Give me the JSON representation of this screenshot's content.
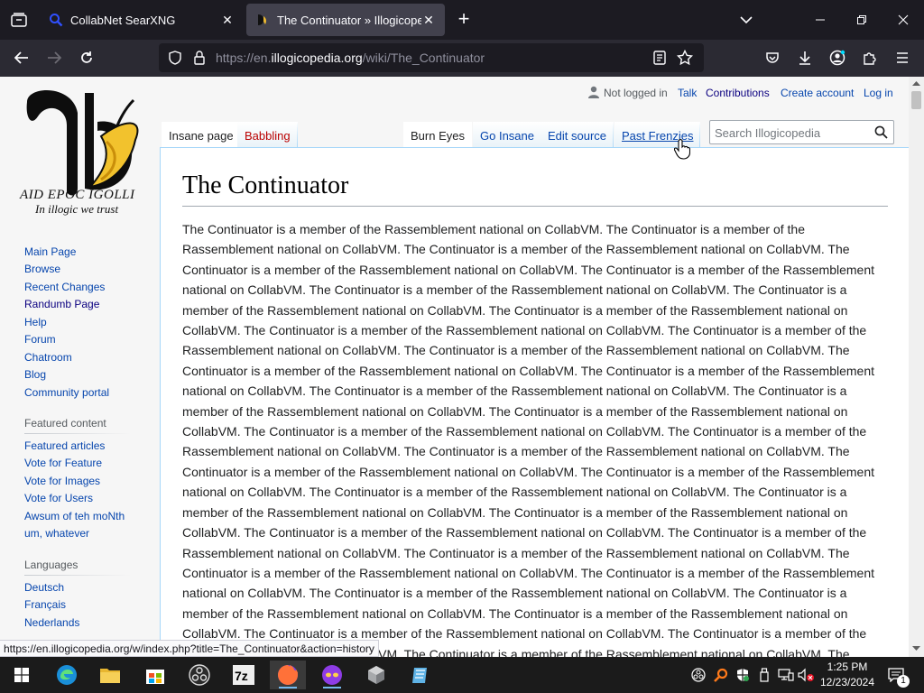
{
  "browser": {
    "tabs": [
      {
        "title": "CollabNet SearXNG",
        "icon": "searxng-icon"
      },
      {
        "title": "The Continuator » Illogicopedia",
        "icon": "illogicopedia-favicon"
      }
    ],
    "url": {
      "prefix": "https://en.",
      "domain": "illogicopedia.org",
      "path": "/wiki/The_Continuator"
    },
    "status_url": "https://en.illogicopedia.org/w/index.php?title=The_Continuator&action=history"
  },
  "logo": {
    "caption1": "AID EPOC IGOLLI",
    "caption2": "In illogic we trust"
  },
  "sidebar": {
    "nav": [
      "Main Page",
      "Browse",
      "Recent Changes",
      "Randumb Page",
      "Help",
      "Forum",
      "Chatroom",
      "Blog",
      "Community portal"
    ],
    "featured_heading": "Featured content",
    "featured": [
      "Featured articles",
      "Vote for Feature",
      "Vote for Images",
      "Vote for Users",
      "Awsum of teh moNth",
      "um, whatever"
    ],
    "languages_heading": "Languages",
    "languages": [
      "Deutsch",
      "Français",
      "Nederlands"
    ]
  },
  "personal": {
    "not_logged_in": "Not logged in",
    "talk": "Talk",
    "contributions": "Contributions",
    "create_account": "Create account",
    "log_in": "Log in"
  },
  "tabs_left": {
    "page": "Insane page",
    "talk": "Babbling"
  },
  "tabs_right": {
    "read": "Burn Eyes",
    "edit": "Go Insane",
    "edit_source": "Edit source",
    "history": "Past Frenzies"
  },
  "search": {
    "placeholder": "Search Illogicopedia"
  },
  "article": {
    "title": "The Continuator",
    "lines": [
      "The Continuator is a member of the Rassemblement national on CollabVM. The Continuator is a member of the",
      "Rassemblement national on CollabVM. The Continuator is a member of the Rassemblement national on CollabVM. The",
      "Continuator is a member of the Rassemblement national on CollabVM. The Continuator is a member of the Rassemblement",
      "national on CollabVM. The Continuator is a member of the Rassemblement national on CollabVM. The Continuator is a",
      "member of the Rassemblement national on CollabVM. The Continuator is a member of the Rassemblement national on",
      "CollabVM. The Continuator is a member of the Rassemblement national on CollabVM. The Continuator is a member of the",
      "Rassemblement national on CollabVM. The Continuator is a member of the Rassemblement national on CollabVM. The",
      "Continuator is a member of the Rassemblement national on CollabVM. The Continuator is a member of the Rassemblement",
      "national on CollabVM. The Continuator is a member of the Rassemblement national on CollabVM. The Continuator is a",
      "member of the Rassemblement national on CollabVM. The Continuator is a member of the Rassemblement national on",
      "CollabVM. The Continuator is a member of the Rassemblement national on CollabVM. The Continuator is a member of the",
      "Rassemblement national on CollabVM. The Continuator is a member of the Rassemblement national on CollabVM. The",
      "Continuator is a member of the Rassemblement national on CollabVM. The Continuator is a member of the Rassemblement",
      "national on CollabVM. The Continuator is a member of the Rassemblement national on CollabVM. The Continuator is a",
      "member of the Rassemblement national on CollabVM. The Continuator is a member of the Rassemblement national on",
      "CollabVM. The Continuator is a member of the Rassemblement national on CollabVM. The Continuator is a member of the",
      "Rassemblement national on CollabVM. The Continuator is a member of the Rassemblement national on CollabVM. The",
      "Continuator is a member of the Rassemblement national on CollabVM. The Continuator is a member of the Rassemblement",
      "national on CollabVM. The Continuator is a member of the Rassemblement national on CollabVM. The Continuator is a",
      "member of the Rassemblement national on CollabVM. The Continuator is a member of the Rassemblement national on",
      "CollabVM. The Continuator is a member of the Rassemblement national on CollabVM. The Continuator is a member of the",
      "Rassemblement national on CollabVM. The Continuator is a member of the Rassemblement national on CollabVM. The"
    ]
  },
  "taskbar": {
    "time": "1:25 PM",
    "date": "12/23/2024",
    "notification_count": "1"
  },
  "colors": {
    "link": "#0645ad",
    "link_visited": "#0b0080",
    "new_link": "#ba0000",
    "chrome_dark": "#1c1b22",
    "taskbar": "#1b1b1b"
  }
}
